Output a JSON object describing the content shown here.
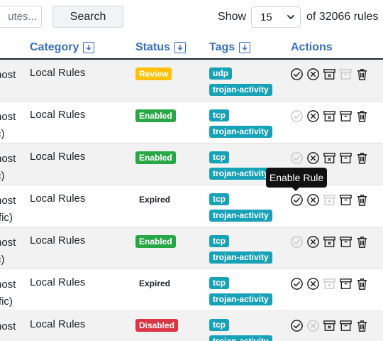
{
  "toolbar": {
    "search_placeholder": "utes...",
    "search_label": "Search",
    "show_label": "Show",
    "page_size": "15",
    "of_label": "of 32066 rules"
  },
  "columns": {
    "category": "Category",
    "status": "Status",
    "tags": "Tags",
    "actions": "Actions"
  },
  "rows": [
    {
      "desc1": "host",
      "desc2": "",
      "category": "Local Rules",
      "status": "Review",
      "tags": [
        "udp",
        "trojan-activity"
      ]
    },
    {
      "desc1": "host",
      "desc2": "c)",
      "category": "Local Rules",
      "status": "Enabled",
      "tags": [
        "tcp",
        "trojan-activity"
      ]
    },
    {
      "desc1": "host",
      "desc2": "c)",
      "category": "Local Rules",
      "status": "Enabled",
      "tags": [
        "tcp",
        "trojan-activity"
      ]
    },
    {
      "desc1": "host",
      "desc2": "ffic)",
      "category": "Local Rules",
      "status": "Expired",
      "tags": [
        "tcp",
        "trojan-activity"
      ]
    },
    {
      "desc1": "host",
      "desc2": "c)",
      "category": "Local Rules",
      "status": "Enabled",
      "tags": [
        "tcp",
        "trojan-activity"
      ]
    },
    {
      "desc1": "host",
      "desc2": "ffic)",
      "category": "Local Rules",
      "status": "Expired",
      "tags": [
        "tcp",
        "trojan-activity"
      ]
    },
    {
      "desc1": "host",
      "desc2": "",
      "category": "Local Rules",
      "status": "Disabled",
      "tags": [
        "tcp",
        "trojan-activity"
      ]
    }
  ],
  "tooltip": "Enable Rule",
  "colors": {
    "link_blue": "#3b6fc4",
    "review": "#ffc107",
    "enabled": "#28a745",
    "disabled": "#dc3545",
    "tag": "#17a2b8"
  },
  "icons": [
    "check-circle-icon",
    "x-circle-icon",
    "archive-x-icon",
    "archive-icon",
    "trash-icon",
    "sort-down-icon",
    "chevron-down-icon"
  ]
}
